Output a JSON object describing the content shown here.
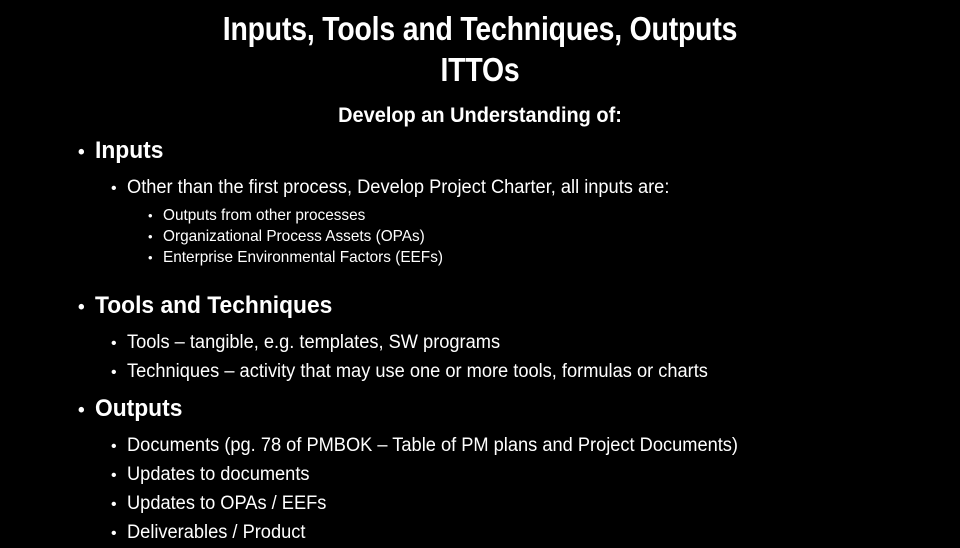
{
  "slide": {
    "background_color": "#000000",
    "text_color": "#ffffff",
    "title": {
      "line1": "Inputs, Tools and Techniques, Outputs",
      "line2": "ITTOs"
    },
    "subtitle": "Develop an Understanding of:",
    "bullet_glyph": "•",
    "sections": [
      {
        "heading": "Inputs",
        "level2": [
          {
            "text": "Other than the first process, Develop Project Charter, all inputs are:",
            "level3": [
              "Outputs from other processes",
              "Organizational Process Assets (OPAs)",
              "Enterprise Environmental Factors (EEFs)"
            ]
          }
        ]
      },
      {
        "heading": "Tools and Techniques",
        "level2": [
          {
            "text": "Tools – tangible, e.g. templates, SW programs",
            "level3": []
          },
          {
            "text": "Techniques – activity that may use one or more tools, formulas or charts",
            "level3": []
          }
        ]
      },
      {
        "heading": "Outputs",
        "level2": [
          {
            "text": "Documents (pg. 78 of PMBOK – Table of PM plans and Project Documents)",
            "level3": []
          },
          {
            "text": "Updates to documents",
            "level3": []
          },
          {
            "text": "Updates to OPAs / EEFs",
            "level3": []
          },
          {
            "text": "Deliverables / Product",
            "level3": []
          }
        ]
      }
    ]
  }
}
